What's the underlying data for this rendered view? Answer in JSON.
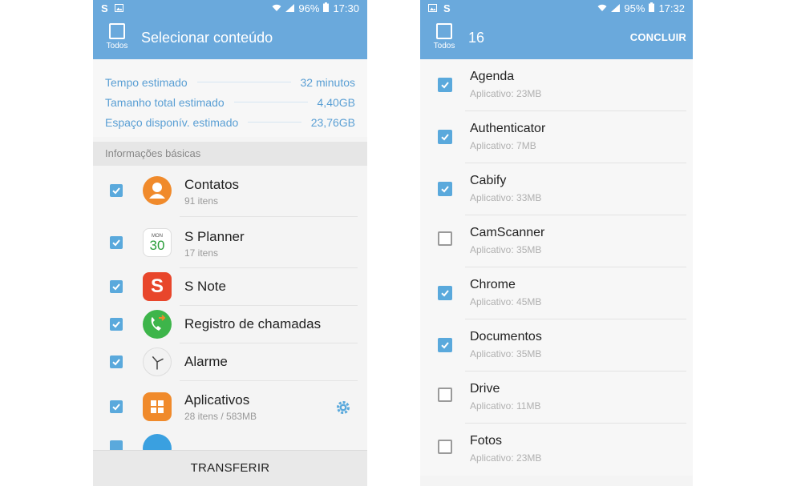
{
  "left": {
    "status": {
      "carrier_icon": "S",
      "battery": "96%",
      "time": "17:30"
    },
    "header": {
      "select_all_label": "Todos",
      "title": "Selecionar conteúdo"
    },
    "summary": [
      {
        "label": "Tempo estimado",
        "value": "32 minutos"
      },
      {
        "label": "Tamanho total estimado",
        "value": "4,40GB"
      },
      {
        "label": "Espaço disponív. estimado",
        "value": "23,76GB"
      }
    ],
    "section_title": "Informações básicas",
    "items": [
      {
        "name": "Contatos",
        "sub": "91 itens",
        "checked": true,
        "icon": "contacts-icon",
        "color": "#f08a2b"
      },
      {
        "name": "S Planner",
        "sub": "17 itens",
        "checked": true,
        "icon": "calendar-icon",
        "color": "#ffffff",
        "icon_month": "MON",
        "icon_day": "30"
      },
      {
        "name": "S Note",
        "sub": "",
        "checked": true,
        "icon": "s-note-icon",
        "color": "#e8462b"
      },
      {
        "name": "Registro de chamadas",
        "sub": "",
        "checked": true,
        "icon": "call-log-icon",
        "color": "#3db54a"
      },
      {
        "name": "Alarme",
        "sub": "",
        "checked": true,
        "icon": "clock-icon",
        "color": "#f2f2f2"
      },
      {
        "name": "Aplicativos",
        "sub": "28 itens / 583MB",
        "checked": true,
        "icon": "apps-icon",
        "color": "#f08a2b"
      }
    ],
    "transfer_label": "TRANSFERIR"
  },
  "right": {
    "status": {
      "carrier_icon": "S",
      "battery": "95%",
      "time": "17:32"
    },
    "header": {
      "select_all_label": "Todos",
      "count": "16",
      "done_label": "CONCLUIR"
    },
    "apps": [
      {
        "name": "Agenda",
        "sub": "Aplicativo: 23MB",
        "checked": true
      },
      {
        "name": "Authenticator",
        "sub": "Aplicativo: 7MB",
        "checked": true
      },
      {
        "name": "Cabify",
        "sub": "Aplicativo: 33MB",
        "checked": true
      },
      {
        "name": "CamScanner",
        "sub": "Aplicativo: 35MB",
        "checked": false
      },
      {
        "name": "Chrome",
        "sub": "Aplicativo: 45MB",
        "checked": true
      },
      {
        "name": "Documentos",
        "sub": "Aplicativo: 35MB",
        "checked": true
      },
      {
        "name": "Drive",
        "sub": "Aplicativo: 11MB",
        "checked": false
      },
      {
        "name": "Fotos",
        "sub": "Aplicativo: 23MB",
        "checked": false
      }
    ]
  },
  "colors": {
    "accent": "#6aa9dc",
    "check": "#5aa9dc",
    "summary_text": "#5a9fd4"
  }
}
